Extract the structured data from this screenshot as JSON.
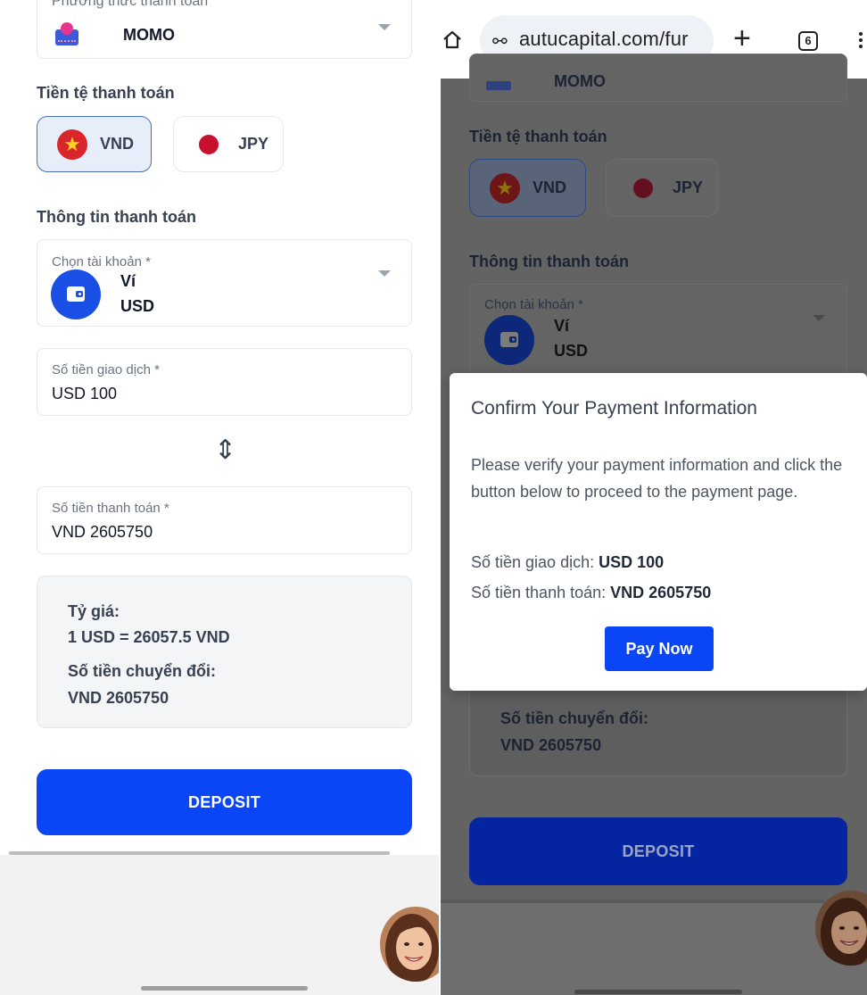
{
  "left": {
    "payment_method_label": "Phương thức thanh toán",
    "payment_method_value": "MOMO",
    "currency_section_title": "Tiền tệ thanh toán",
    "currency_options": [
      "VND",
      "JPY"
    ],
    "selected_currency": "VND",
    "info_section_title": "Thông tin thanh toán",
    "account_label": "Chọn tài khoản *",
    "account_name": "Ví",
    "account_currency": "USD",
    "transaction_amount_label": "Số tiền giao dịch *",
    "transaction_amount_value": "USD 100",
    "payment_amount_label": "Số tiền thanh toán *",
    "payment_amount_value": "VND 2605750",
    "rate_label": "Tỷ giá:",
    "rate_value": "1 USD = 26057.5 VND",
    "converted_label": "Số tiền chuyển đổi:",
    "converted_value": "VND 2605750",
    "deposit_button": "DEPOSIT",
    "swap_icon": "⇕"
  },
  "right": {
    "browser": {
      "url": "autucapital.com/fur",
      "tab_count": "6",
      "new_tab_icon": "+",
      "site_info_icon": "⚯"
    },
    "payment_method_value": "MOMO",
    "currency_section_title": "Tiền tệ thanh toán",
    "currency_options": [
      "VND",
      "JPY"
    ],
    "info_section_title": "Thông tin thanh toán",
    "account_label": "Chọn tài khoản *",
    "account_name": "Ví",
    "account_currency": "USD",
    "converted_label": "Số tiền chuyển đổi:",
    "converted_value": "VND 2605750",
    "deposit_button": "DEPOSIT",
    "modal": {
      "title": "Confirm Your Payment Information",
      "body": "Please verify your payment information and click the button below to proceed to the payment page.",
      "transaction_label": "Số tiền giao dịch:",
      "transaction_value": "USD 100",
      "payment_label": "Số tiền thanh toán:",
      "payment_value": "VND 2605750",
      "pay_button": "Pay Now"
    }
  },
  "colors": {
    "primary": "#0a46f5",
    "overlay": "#636363",
    "vn_red": "#d9262a",
    "jp_red": "#c8102e"
  }
}
